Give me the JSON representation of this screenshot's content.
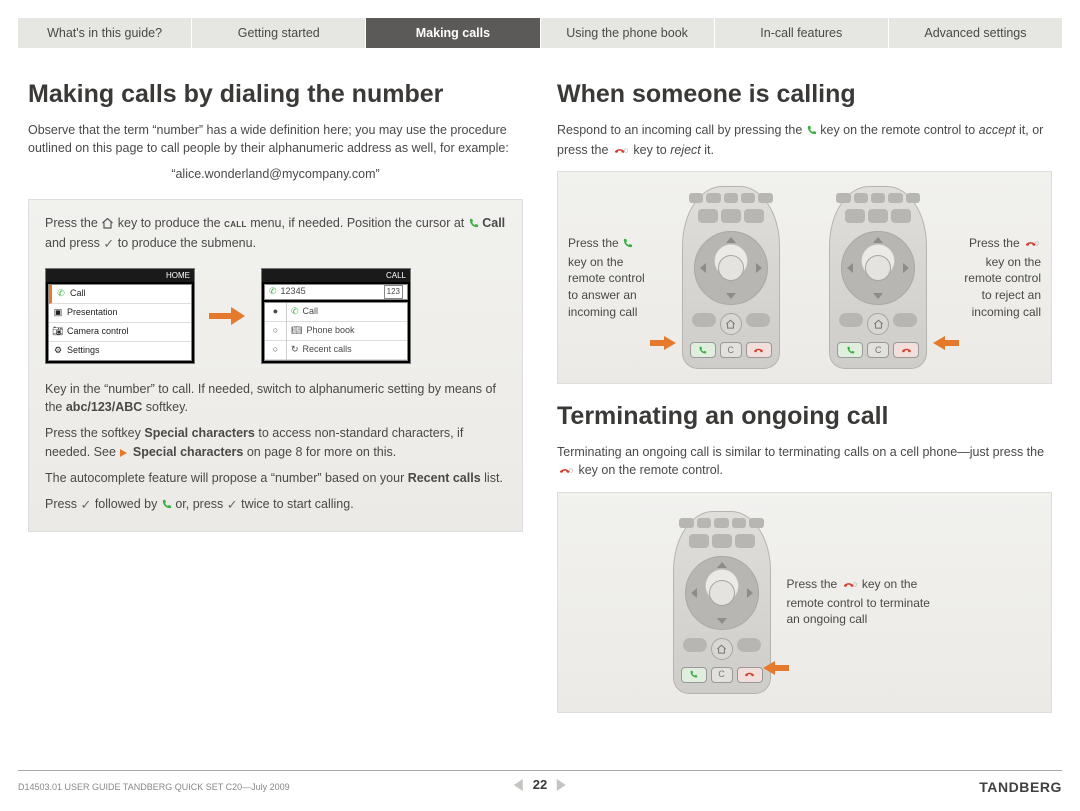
{
  "tabs": [
    {
      "label": "What's in this guide?",
      "active": false
    },
    {
      "label": "Getting started",
      "active": false
    },
    {
      "label": "Making calls",
      "active": true
    },
    {
      "label": "Using the phone book",
      "active": false
    },
    {
      "label": "In-call features",
      "active": false
    },
    {
      "label": "Advanced settings",
      "active": false
    }
  ],
  "left": {
    "heading": "Making calls by dialing the number",
    "intro": "Observe that the term “number” has a wide definition here; you may use the procedure outlined on this page to call people by their alphanumeric address as well, for example:",
    "example": "“alice.wonderland@mycompany.com”",
    "panel": {
      "step1_a": "Press the ",
      "step1_b": " key to produce the ",
      "step1_callword": "call",
      "step1_c": " menu, if needed. Position the cursor at ",
      "step1_call_label": "Call",
      "step1_d": " and press ",
      "step1_f": " to produce the submenu.",
      "home_menu": {
        "title": "HOME",
        "items": [
          "Call",
          "Presentation",
          "Camera control",
          "Settings"
        ]
      },
      "call_menu": {
        "title": "CALL",
        "input": "12345",
        "items": [
          "Call",
          "Phone book",
          "Recent calls"
        ]
      },
      "step2": "Key in the “number” to call. If needed, switch to alphanumeric setting by means of the ",
      "step2_softkey": "abc/123/ABC",
      "step2_tail": " softkey.",
      "step3_a": "Press the softkey ",
      "step3_sc": "Special characters",
      "step3_b": " to access non-standard characters, if needed. See ",
      "step3_link": "Special characters",
      "step3_c": " on page 8 for more on this.",
      "step4": "The autocomplete feature will propose a “number” based on your ",
      "step4_b": "Recent calls",
      "step4_tail": " list.",
      "step5_a": "Press ",
      "step5_b": " followed by ",
      "step5_c": " or, press ",
      "step5_d": " twice to start calling."
    }
  },
  "right": {
    "incoming": {
      "heading": "When someone is calling",
      "intro_a": "Respond to an incoming call by pressing the ",
      "intro_b": " key on the remote control to ",
      "intro_accept": "accept",
      "intro_c": " it, or press the ",
      "intro_d": " key to ",
      "intro_reject": "reject",
      "intro_e": " it.",
      "cap_left_a": "Press the ",
      "cap_left_b": " key on the remote control to answer an incoming call",
      "cap_right_a": "Press the ",
      "cap_right_b": " key on the remote control to reject an incoming call"
    },
    "terminate": {
      "heading": "Terminating an ongoing call",
      "intro_a": "Terminating an ongoing call is similar to terminating calls on a cell phone—just press the ",
      "intro_b": " key on the remote control.",
      "cap_a": "Press the ",
      "cap_b": " key on the remote control to terminate an ongoing call"
    }
  },
  "footer": {
    "doc": "D14503.01 USER GUIDE TANDBERG QUICK SET C20—July 2009",
    "page": "22",
    "brand": "TANDBERG"
  },
  "chart_data": null
}
